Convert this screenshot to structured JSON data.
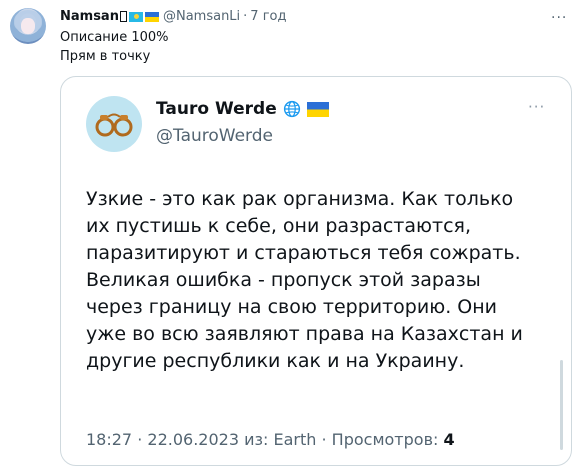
{
  "post": {
    "display_name": "Namsan",
    "handle": "@NamsanLi",
    "separator": "·",
    "time": "7 год",
    "text_lines": [
      "Описание 100%",
      "Прям в точку"
    ],
    "more": "···"
  },
  "quoted": {
    "display_name": "Tauro Werde",
    "handle": "@TauroWerde",
    "more": "···",
    "body_lines": [
      "Узкие - это как рак организма. Как только",
      "их пустишь к себе, они разрастаются,",
      "паразитируют и стараються тебя сожрать.",
      "Великая ошибка - пропуск этой заразы",
      "через границу на свою территорию. Они",
      "уже во всю заявляют права на Казахстан и",
      "другие республики как и на Украину."
    ],
    "meta_time": "18:27",
    "meta_sep1": "·",
    "meta_date": "22.06.2023",
    "meta_source": "из: Earth",
    "meta_sep2": "·",
    "meta_views_label": "Просмотров:",
    "meta_views_count": "4"
  },
  "colors": {
    "muted": "#536471",
    "border": "#cfd9de",
    "avatar_bg": "#bfe4f1",
    "globe": "#1d9bf0"
  },
  "icons": [
    "kazakhstan-flag-icon",
    "ukraine-flag-icon",
    "globe-icon",
    "handcuffs-icon",
    "more-icon"
  ]
}
